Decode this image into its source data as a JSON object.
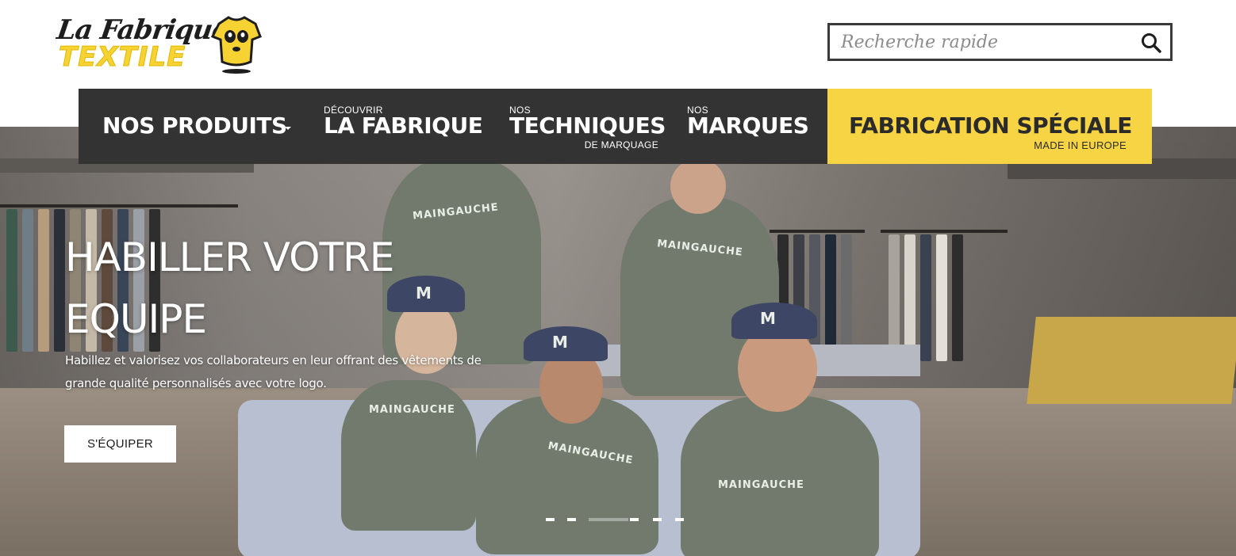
{
  "logo": {
    "line1": "La Fabrique",
    "line2": "TEXTILE"
  },
  "search": {
    "placeholder": "Recherche rapide",
    "value": ""
  },
  "nav": {
    "items": [
      {
        "small": "",
        "label": "NOS PRODUITS",
        "sub": ""
      },
      {
        "small": "DÉCOUVRIR",
        "label": "LA FABRIQUE",
        "sub": ""
      },
      {
        "small": "NOS",
        "label": "TECHNIQUES",
        "sub": "DE MARQUAGE"
      },
      {
        "small": "NOS",
        "label": "MARQUES",
        "sub": ""
      }
    ],
    "special": {
      "label": "FABRICATION SPÉCIALE",
      "sub": "MADE IN EUROPE"
    }
  },
  "hero": {
    "title": "HABILLER VOTRE EQUIPE",
    "description": "Habillez et valorisez vos collaborateurs en leur offrant des vêtements de grande qualité personnalisés avec votre logo.",
    "cta": "S'ÉQUIPER",
    "slide_count": 6,
    "active_slide": 2,
    "shirt_print": "MAINGAUCHE",
    "cap_print": "M"
  },
  "colors": {
    "accent": "#f7d444",
    "nav_bg": "#333333",
    "text_dark": "#2b2b2b"
  }
}
